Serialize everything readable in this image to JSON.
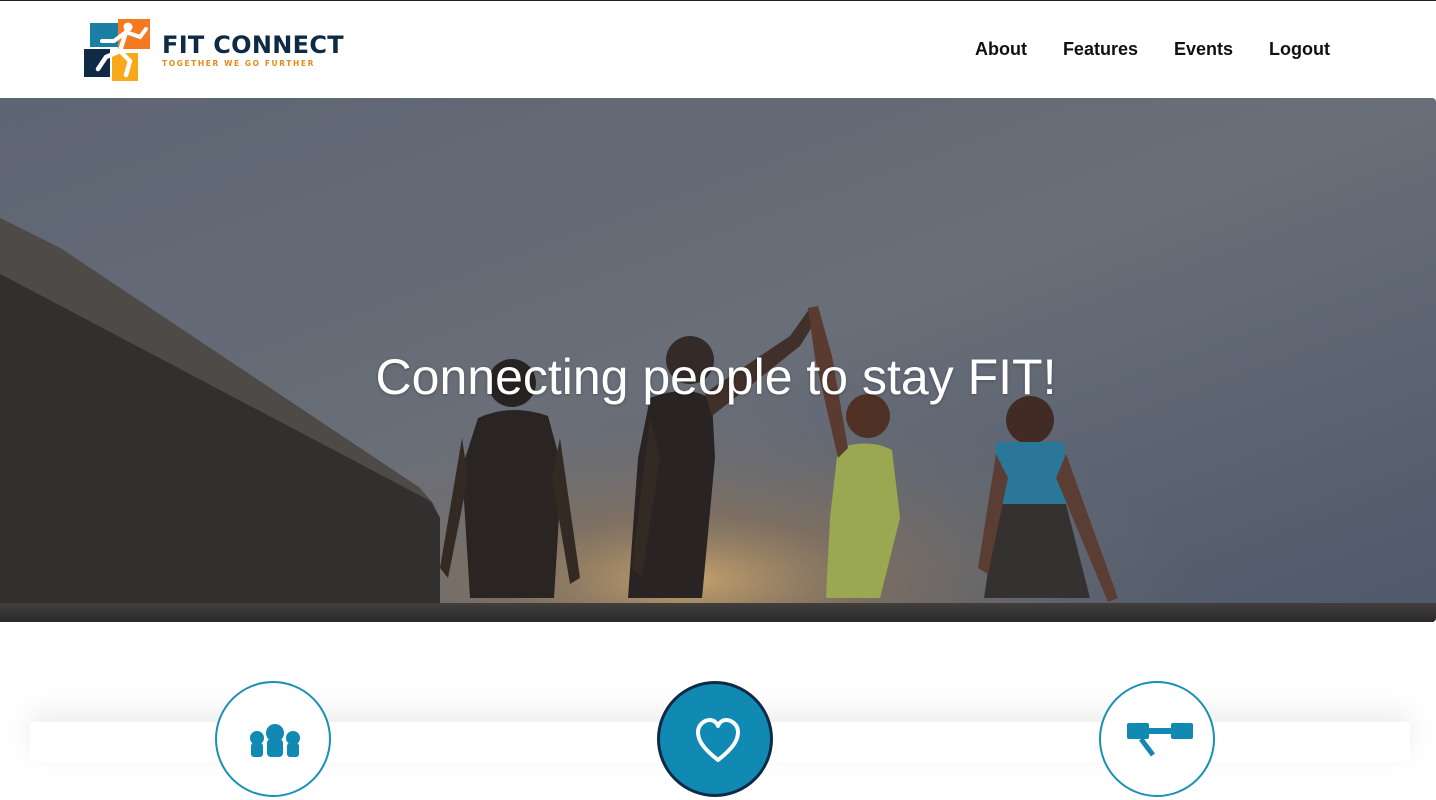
{
  "brand": {
    "title": "FIT CONNECT",
    "tagline": "TOGETHER WE GO FURTHER",
    "colors": {
      "navy": "#0f2a44",
      "orange": "#f47a20",
      "teal": "#1a8fb5",
      "yellow": "#f7a81b"
    }
  },
  "nav": {
    "items": [
      {
        "label": "About"
      },
      {
        "label": "Features"
      },
      {
        "label": "Events"
      },
      {
        "label": "Logout"
      }
    ]
  },
  "hero": {
    "headline": "Connecting people to stay FIT!",
    "image": "group-high-five-at-sunset-photo"
  },
  "features": {
    "icons": [
      "community-icon",
      "heart-icon",
      "dumbbell-icon"
    ],
    "accent": "#1089b3"
  }
}
